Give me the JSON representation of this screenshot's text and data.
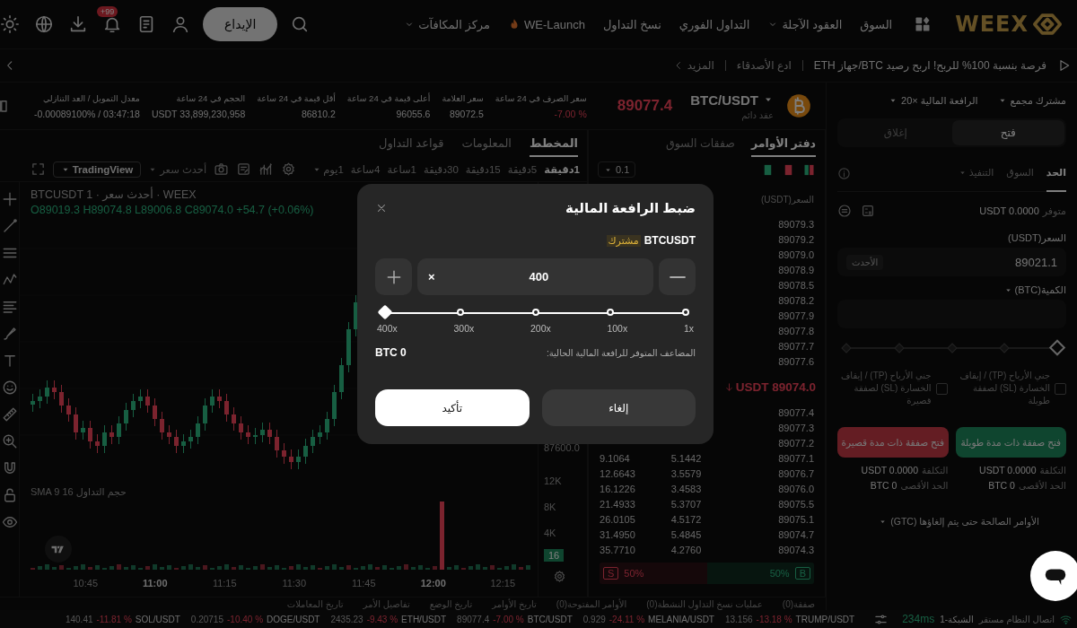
{
  "header": {
    "logo": "WEEX",
    "nav": [
      {
        "label": "السوق",
        "dropdown": false,
        "hot": false
      },
      {
        "label": "العقود الآجلة",
        "dropdown": true,
        "hot": false
      },
      {
        "label": "التداول الفوري",
        "dropdown": false,
        "hot": false
      },
      {
        "label": "نسخ التداول",
        "dropdown": false,
        "hot": false
      },
      {
        "label": "WE-Launch",
        "dropdown": false,
        "hot": true
      },
      {
        "label": "مركز المكافآت",
        "dropdown": true,
        "hot": false
      }
    ],
    "deposit": "الإيداع",
    "notification_badge": "+99"
  },
  "announcement": {
    "text": "فرصة بنسبة 100% للربح! اربح رصيد BTC/جهاز ETH",
    "invite": "ادع الأصدقاء",
    "more": "المزيد"
  },
  "market": {
    "symbol": "BTC/USDT",
    "contract_type": "عقد دائم",
    "price": "89077.4",
    "negative": true,
    "stats": [
      {
        "label": "سعر الصرف في 24 ساعة",
        "value": "-7.00 %",
        "negative": true
      },
      {
        "label": "سعر العلامة",
        "value": "89072.5",
        "negative": false
      },
      {
        "label": "أعلى قيمة في 24 ساعة",
        "value": "96055.6",
        "negative": false
      },
      {
        "label": "أقل قيمة في 24 ساعة",
        "value": "86810.2",
        "negative": false
      },
      {
        "label": "الحجم في 24 ساعة",
        "value": "USDT 33,899,230,958",
        "negative": false
      },
      {
        "label": "معدل التمويل / العد التنازلي",
        "value": "-0.00089100% / 03:47:18",
        "negative": false
      }
    ]
  },
  "chart": {
    "tabs": [
      {
        "label": "المخطط",
        "selected": true
      },
      {
        "label": "المعلومات",
        "selected": false
      },
      {
        "label": "قواعد التداول",
        "selected": false
      }
    ],
    "intervals": [
      {
        "label": "1دقيقة",
        "selected": true,
        "dropdown": false
      },
      {
        "label": "5دقيقة",
        "selected": false,
        "dropdown": false
      },
      {
        "label": "15دقيقة",
        "selected": false,
        "dropdown": false
      },
      {
        "label": "30دقيقة",
        "selected": false,
        "dropdown": false
      },
      {
        "label": "1ساعة",
        "selected": false,
        "dropdown": false
      },
      {
        "label": "4ساعة",
        "selected": false,
        "dropdown": false
      },
      {
        "label": "1يوم",
        "selected": false,
        "dropdown": true
      }
    ],
    "price_type": "أحدث سعر",
    "provider": "TradingView",
    "legend": "BTCUSDT أحدث سعر · 1 · WEEX",
    "ohlc": "O89019.3 H89074.8 L89006.8 C89074.0 +54.7 (+0.06%)",
    "volume_legend": "حجم التداول SMA 9 16",
    "price_axis": [
      "87600.0"
    ],
    "volume_axis": [
      "12K",
      "8K",
      "4K"
    ],
    "volume_tag": "16",
    "time_axis": [
      "12:15",
      "12:00",
      "11:45",
      "11:30",
      "11:15",
      "11:00",
      "10:45"
    ]
  },
  "order_book": {
    "tabs": [
      {
        "label": "دفتر الأوامر",
        "selected": true
      },
      {
        "label": "صفقات السوق",
        "selected": false
      }
    ],
    "precision": "0.1",
    "price_header": "السعر(USDT)",
    "asks": [
      {
        "price": "89079.3"
      },
      {
        "price": "89079.2"
      },
      {
        "price": "89079.0"
      },
      {
        "price": "89078.9"
      },
      {
        "price": "89078.5"
      },
      {
        "price": "89078.2"
      },
      {
        "price": "89077.9"
      },
      {
        "price": "89077.8"
      },
      {
        "price": "89077.7"
      },
      {
        "price": "89077.6"
      }
    ],
    "last_price": "USDT 89074.0",
    "bids": [
      {
        "price": "89077.4"
      },
      {
        "price": "89077.3"
      },
      {
        "price": "89077.2"
      },
      {
        "price": "89077.1",
        "column_2": "5.1442",
        "column_3": "9.1064"
      },
      {
        "price": "89076.7",
        "column_2": "3.5579",
        "column_3": "12.6643"
      },
      {
        "price": "89076.0",
        "column_2": "3.4583",
        "column_3": "16.1226"
      },
      {
        "price": "89075.5",
        "column_2": "5.3707",
        "column_3": "21.4933"
      },
      {
        "price": "89075.1",
        "column_2": "4.5172",
        "column_3": "26.0105"
      },
      {
        "price": "89074.7",
        "column_2": "5.4845",
        "column_3": "31.4950"
      },
      {
        "price": "89074.3",
        "column_2": "4.2760",
        "column_3": "35.7710"
      }
    ],
    "buy_label": "B",
    "buy_ratio": "50%",
    "sell_ratio": "50%",
    "sell_label": "S"
  },
  "order_panel": {
    "margin_mode": "مشترك مجمع",
    "leverage": "الرافعة المالية ×20",
    "sides": [
      {
        "label": "فتح",
        "selected": true
      },
      {
        "label": "إغلاق",
        "selected": false
      }
    ],
    "order_types": [
      {
        "label": "الحد",
        "selected": true,
        "dropdown": false
      },
      {
        "label": "السوق",
        "selected": false,
        "dropdown": false
      },
      {
        "label": "التنفيذ",
        "selected": false,
        "dropdown": true
      }
    ],
    "available_label": "متوفر",
    "available": "USDT 0.0000",
    "price_label": "السعر(USDT)",
    "price": "89021.1",
    "latest": "الأحدث",
    "quantity_label": "الكمية(BTC)",
    "amount_slider": {
      "level": 0
    },
    "tp_sl": [
      {
        "label": "جني الأرباح (TP) / إيقاف الخسارة (SL) لصفقة طويلة",
        "checked": false
      },
      {
        "label": "جني الأرباح (TP) / إيقاف الخسارة (SL) لصفقة قصيرة",
        "checked": false
      }
    ],
    "buttons": [
      {
        "label": "فتح صفقة ذات مدة طويلة",
        "kind": "long"
      },
      {
        "label": "فتح صفقة ذات مدة قصيرة",
        "kind": "short"
      }
    ],
    "summaries": [
      {
        "cost_label": "التكلفة",
        "cost": "USDT 0.0000",
        "max_label": "الحد الأقصى",
        "max": "BTC 0"
      },
      {
        "cost_label": "التكلفة",
        "cost": "USDT 0.0000",
        "max_label": "الحد الأقصى",
        "max": "BTC 0"
      }
    ],
    "time_in_force": "الأوامر الصالحة حتى يتم إلغاؤها (GTC)"
  },
  "bottom_tabs": [
    "صفقة(0)",
    "عمليات نسخ التداول النشطة(0)",
    "الأوامر المفتوحة(0)",
    "تاريخ الأوامر",
    "تاريخ الوضع",
    "تفاصيل الأمر",
    "تاريخ المعاملات"
  ],
  "status_bar": {
    "connection": "اتصال النظام مستقر",
    "network": "الشبكة-1",
    "latency": "234ms",
    "tickers": [
      {
        "symbol": "TRUMP/USDT",
        "change": "-13.18 %",
        "price": "13.156"
      },
      {
        "symbol": "MELANIA/USDT",
        "change": "-24.11 %",
        "price": "0.929"
      },
      {
        "symbol": "BTC/USDT",
        "change": "-7.00 %",
        "price": "89077.4"
      },
      {
        "symbol": "ETH/USDT",
        "change": "-9.43 %",
        "price": "2435.23"
      },
      {
        "symbol": "DOGE/USDT",
        "change": "-10.40 %",
        "price": "0.20715"
      },
      {
        "symbol": "SOL/USDT",
        "change": "-11.81 %",
        "price": "140.41"
      }
    ]
  },
  "modal": {
    "title": "ضبط الرافعة المالية",
    "symbol": "BTCUSDT",
    "mode_tag": "مشترك",
    "value": "400",
    "suffix": "×",
    "level": 1,
    "marks": [
      "1x",
      "100x",
      "200x",
      "300x",
      "400x"
    ],
    "info_label": "المضاعف المتوفر للرافعة المالية الحالية:",
    "info_value": "BTC 0",
    "cancel": "إلغاء",
    "confirm": "تأكيد"
  }
}
